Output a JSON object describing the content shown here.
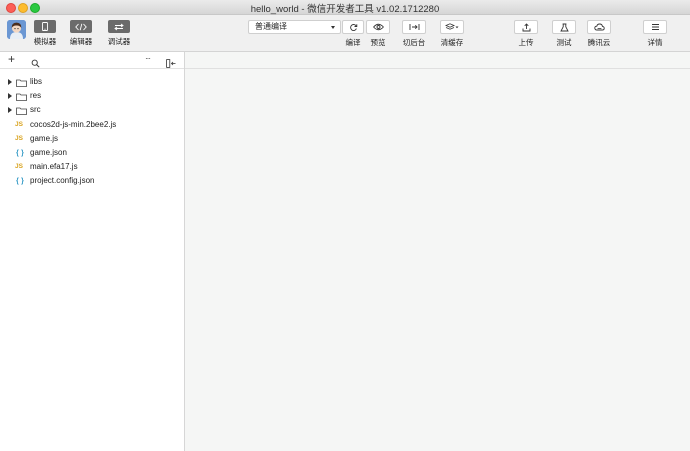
{
  "window": {
    "title": "hello_world - 微信开发者工具 v1.02.1712280"
  },
  "modes": [
    {
      "label": "模拟器",
      "icon": "phone-icon"
    },
    {
      "label": "编辑器",
      "icon": "code-icon"
    },
    {
      "label": "调试器",
      "icon": "debug-icon"
    }
  ],
  "compile": {
    "selected": "普通编译"
  },
  "actions": {
    "compile": "编译",
    "preview": "预览",
    "background": "切后台",
    "clear_cache": "清缓存",
    "upload": "上传",
    "test": "测试",
    "tencent_cloud": "腾讯云",
    "details": "详情"
  },
  "sidebar": {
    "add_icon": "plus-icon",
    "search_icon": "search-icon",
    "more_label": "···",
    "collapse_icon": "collapse-panel-icon"
  },
  "files": [
    {
      "name": "libs",
      "type": "folder"
    },
    {
      "name": "res",
      "type": "folder"
    },
    {
      "name": "src",
      "type": "folder"
    },
    {
      "name": "cocos2d-js-min.2bee2.js",
      "type": "js",
      "badge": "JS"
    },
    {
      "name": "game.js",
      "type": "js",
      "badge": "JS"
    },
    {
      "name": "game.json",
      "type": "json",
      "badge": "{ }"
    },
    {
      "name": "main.efa17.js",
      "type": "js",
      "badge": "JS"
    },
    {
      "name": "project.config.json",
      "type": "json",
      "badge": "{ }"
    }
  ],
  "colors": {
    "folder_stroke": "#444444",
    "js_badge": "#d9a31e",
    "json_badge": "#3e9fc9",
    "mode_button": "#6b6b6b"
  }
}
